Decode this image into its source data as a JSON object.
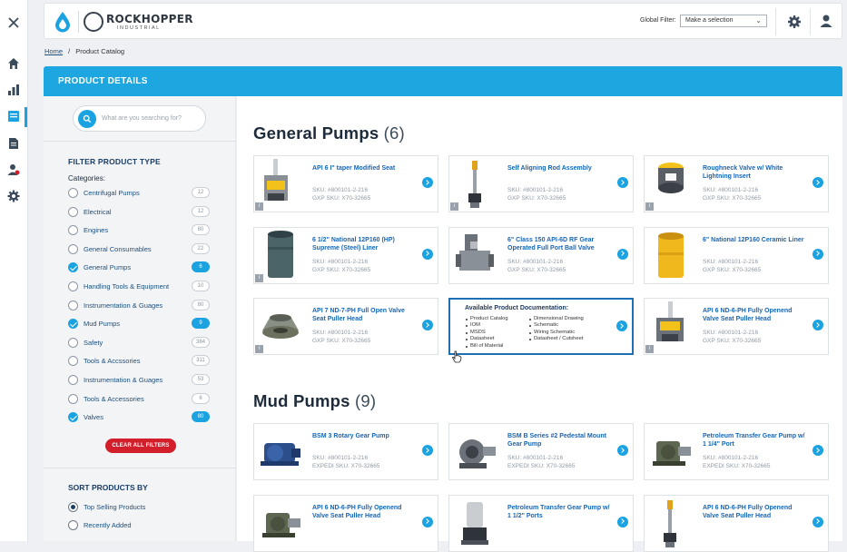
{
  "app": {
    "brand": "ROCKHOPPER",
    "brand_sub": "INDUSTRIAL",
    "brand_color": "#1aa3e0",
    "accent": "#1aa3e0",
    "danger": "#d31f2b"
  },
  "rail": {
    "items": [
      "close-icon",
      "home-icon",
      "chart-icon",
      "catalog-icon",
      "document-icon",
      "alert-user-icon",
      "gear-icon"
    ]
  },
  "topbar": {
    "global_filter_label": "Global Filter:",
    "global_filter_value": "Make a selection"
  },
  "breadcrumb": {
    "home": "Home",
    "separator": "/",
    "current": "Product Catalog"
  },
  "banner": {
    "title": "PRODUCT DETAILS"
  },
  "sidebar": {
    "search_placeholder": "What are you searching for?",
    "filter_heading": "FILTER PRODUCT TYPE",
    "categories_label": "Categories:",
    "categories": [
      {
        "name": "Centrifugal Pumps",
        "count": "12",
        "checked": false
      },
      {
        "name": "Electrical",
        "count": "12",
        "checked": false
      },
      {
        "name": "Engines",
        "count": "80",
        "checked": false
      },
      {
        "name": "General Consumables",
        "count": "22",
        "checked": false
      },
      {
        "name": "General Pumps",
        "count": "6",
        "checked": true
      },
      {
        "name": "Handling Tools & Equipment",
        "count": "10",
        "checked": false
      },
      {
        "name": "Instrumentation & Guages",
        "count": "80",
        "checked": false
      },
      {
        "name": "Mud Pumps",
        "count": "9",
        "checked": true
      },
      {
        "name": "Safety",
        "count": "384",
        "checked": false
      },
      {
        "name": "Tools & Accssories",
        "count": "311",
        "checked": false
      },
      {
        "name": "Instrumentation & Guages",
        "count": "53",
        "checked": false
      },
      {
        "name": "Tools & Accessories",
        "count": "6",
        "checked": false
      },
      {
        "name": "Valves",
        "count": "80",
        "checked": true
      }
    ],
    "clear_label": "CLEAR ALL FILTERS",
    "sort_heading": "SORT PRODUCTS BY",
    "sort_options": [
      {
        "name": "Top Selling Products",
        "selected": true
      },
      {
        "name": "Recently Added",
        "selected": false
      }
    ]
  },
  "sections": [
    {
      "title": "General Pumps",
      "count": "(6)",
      "products": [
        {
          "name": "API 6 I\" taper Modified Seat",
          "sku": "SKU: #800101-2-216",
          "sku2": "GXP SKU: X70-32665",
          "thumb": "seat",
          "badge": true
        },
        {
          "name": "Self Aligning Rod Assembly",
          "sku": "SKU: #800101-2-216",
          "sku2": "GXP SKU: X70-32665",
          "thumb": "rod",
          "badge": true
        },
        {
          "name": "Roughneck Valve w/ White Lightning Insert",
          "sku": "SKU: #800101-2-216",
          "sku2": "GXP SKU: X70-32665",
          "thumb": "valve-yellow",
          "badge": true
        },
        {
          "name": "6 1/2\" National 12P160 (HP) Supreme (Steel) Liner",
          "sku": "SKU: #800101-2-216",
          "sku2": "GXP SKU: X70-32665",
          "thumb": "liner-dark",
          "badge": true
        },
        {
          "name": "6\" Class 150 API-6D RF Gear Operated Full Port Ball Valve",
          "sku": "SKU: #800101-2-216",
          "sku2": "GXP SKU: X70-32665",
          "thumb": "ball-valve",
          "badge": false
        },
        {
          "name": "6\" National 12P160 Ceramic Liner",
          "sku": "SKU: #800101-2-216",
          "sku2": "GXP SKU: X70-32665",
          "thumb": "liner-yellow",
          "badge": false
        },
        {
          "name": "API 7 ND-7-PH Full Open Valve Seat Puller Head",
          "sku": "SKU: #800101-2-216",
          "sku2": "GXP SKU: X70-32665",
          "thumb": "puller-cone",
          "badge": true
        },
        {
          "doc": true,
          "doc_title": "Available Product Documentation:",
          "doc_left": [
            "Product Catalog",
            "IOM",
            "MSDS",
            "Datasheet",
            "Bill of Material"
          ],
          "doc_right": [
            "Dimensional Drawing",
            "Schematic",
            "Wiring Schematic",
            "Datasheet / Cutsheet"
          ]
        },
        {
          "name": "API 6 ND-6-PH Fully Openend Valve Seat Puller Head",
          "sku": "SKU: #800101-2-216",
          "sku2": "GXP SKU: X70-32665",
          "thumb": "puller-yellow",
          "badge": true
        }
      ]
    },
    {
      "title": "Mud Pumps",
      "count": "(9)",
      "products": [
        {
          "name": "BSM 3 Rotary Gear Pump",
          "sku": "SKU: #800101-2-216",
          "sku2": "EXPEDI SKU: X70-32665",
          "thumb": "pump-blue",
          "badge": false
        },
        {
          "name": "BSM B Series #2 Pedestal Mount Gear Pump",
          "sku": "SKU: #800101-2-216",
          "sku2": "EXPEDI SKU: X70-32665",
          "thumb": "pump-grey",
          "badge": false
        },
        {
          "name": "Petroleum Transfer Gear Pump w/ 1 1/4\" Port",
          "sku": "SKU: #800101-2-216",
          "sku2": "EXPEDI SKU: X70-32665",
          "thumb": "pump-green",
          "badge": false
        },
        {
          "name": "API 6 ND-6-PH Fully Openend Valve Seat Puller Head",
          "sku": "",
          "sku2": "",
          "thumb": "pump-green",
          "badge": false
        },
        {
          "name": "Petroleum Transfer Gear Pump w/ 1 1/2\" Ports",
          "sku": "",
          "sku2": "",
          "thumb": "pump-steel",
          "badge": false
        },
        {
          "name": "API 6 ND-6-PH Fully Openend Valve Seat Puller Head",
          "sku": "",
          "sku2": "",
          "thumb": "rod",
          "badge": false
        }
      ]
    }
  ]
}
